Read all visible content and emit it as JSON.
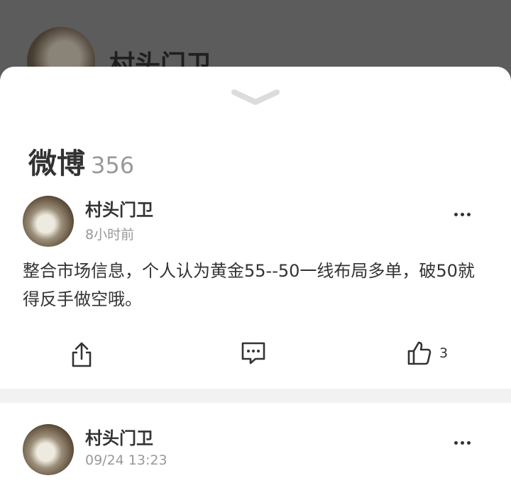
{
  "background": {
    "author_name": "村头门卫"
  },
  "section": {
    "title": "微博",
    "count": "356"
  },
  "posts": [
    {
      "author": "村头门卫",
      "time": "8小时前",
      "content": "整合市场信息，个人认为黄金55--50一线布局多单，破50就得反手做空哦。",
      "likes": "3"
    },
    {
      "author": "村头门卫",
      "time": "09/24 13:23",
      "content": ""
    }
  ],
  "colors": {
    "text": "#333333",
    "muted": "#999999",
    "divider": "#f2f2f2",
    "sheet": "#ffffff"
  }
}
